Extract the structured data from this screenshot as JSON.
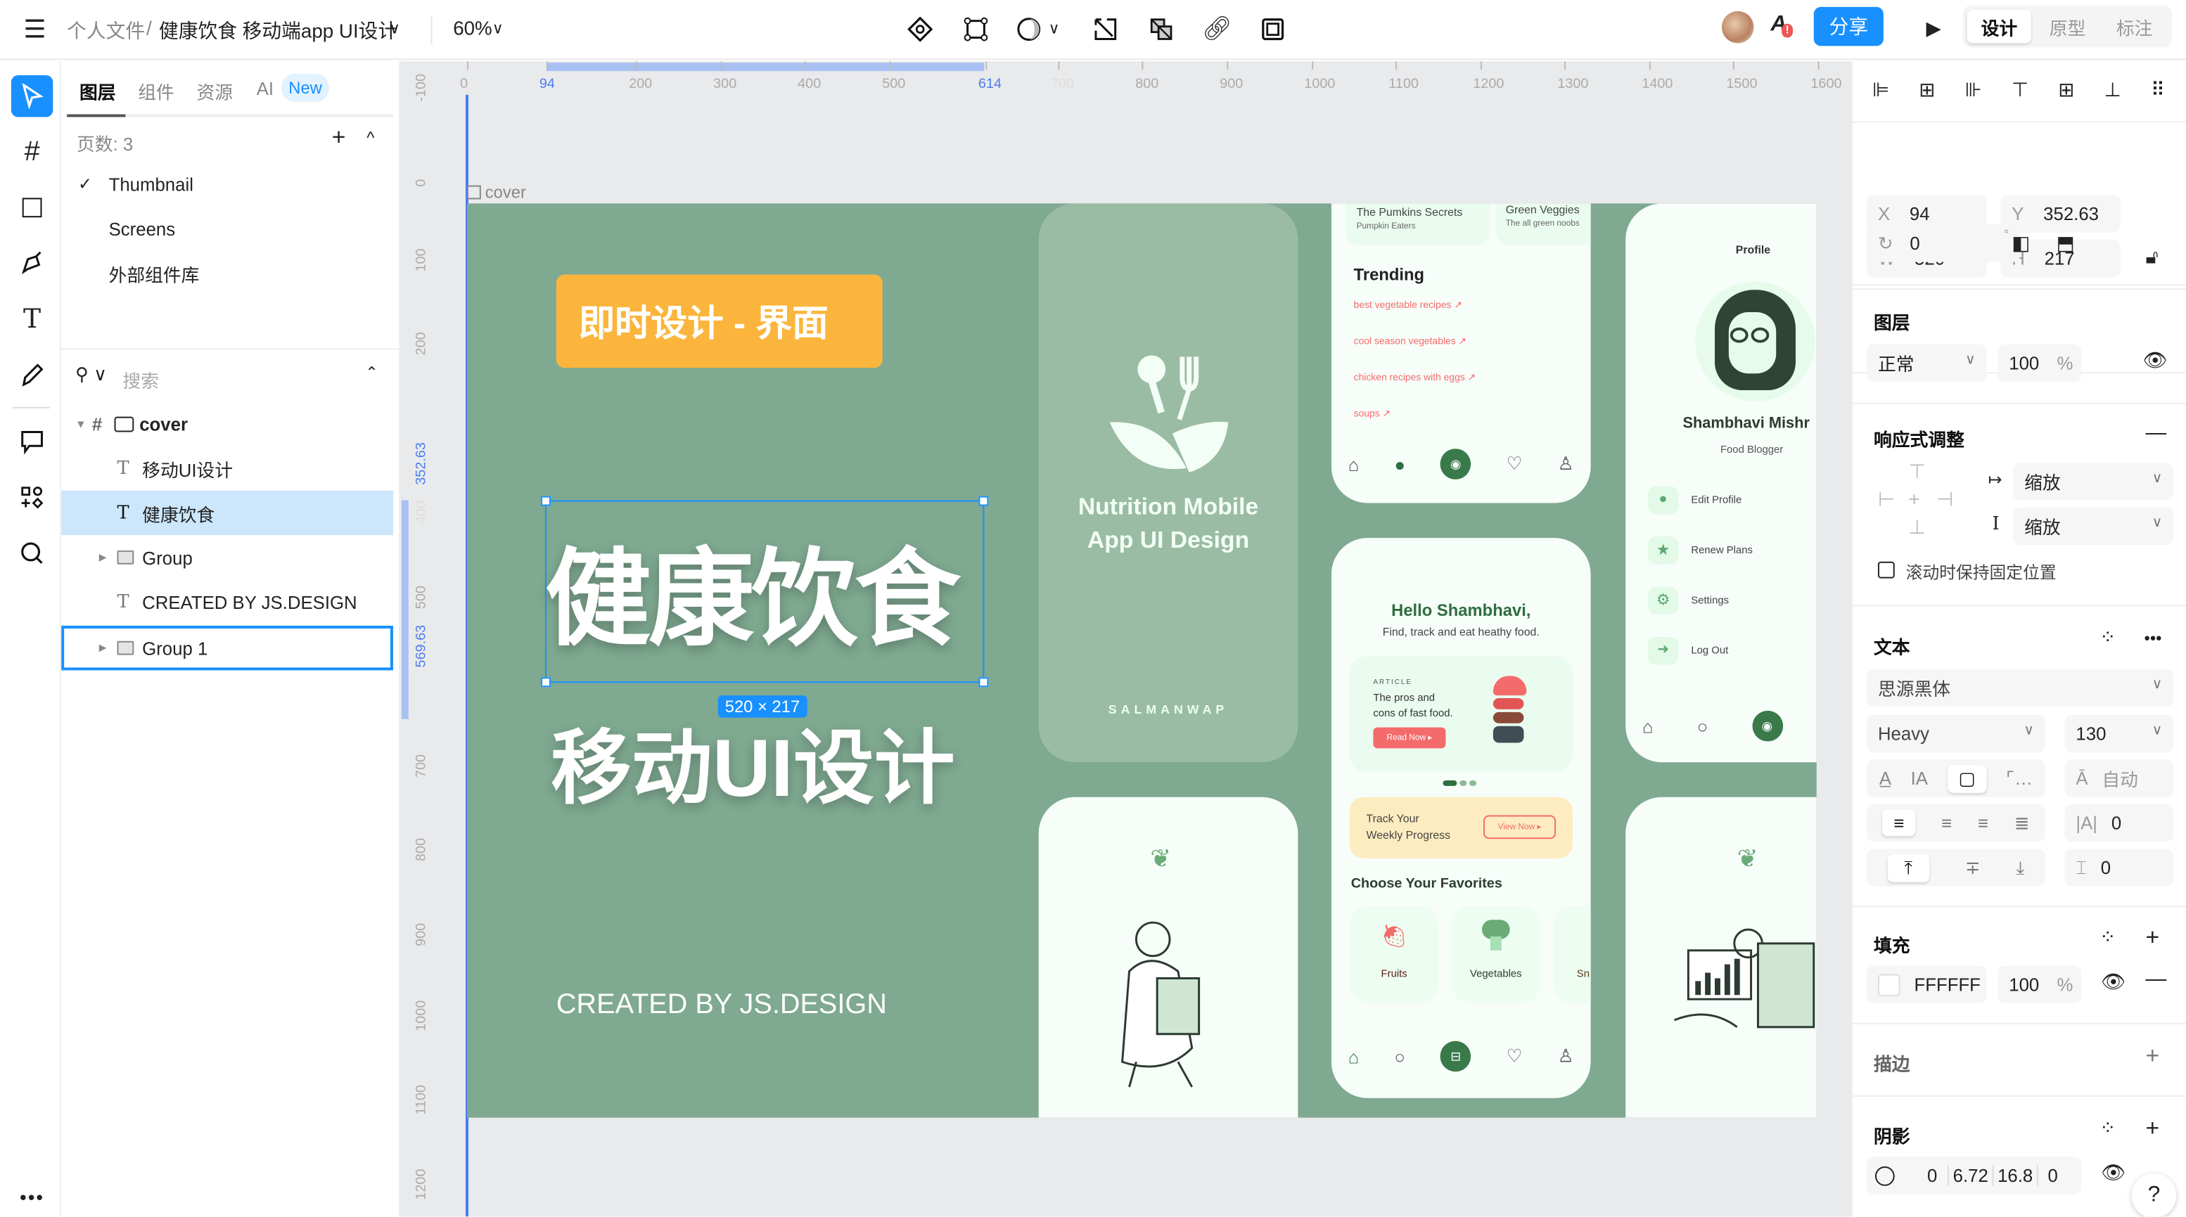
{
  "topbar": {
    "breadcrumb_root": "个人文件",
    "separator": "/",
    "file_name": "健康饮食 移动端app UI设计",
    "zoom": "60%",
    "share_label": "分享",
    "modes": [
      "设计",
      "原型",
      "标注"
    ],
    "active_mode": "设计"
  },
  "left_panel": {
    "tabs": [
      "图层",
      "组件",
      "资源",
      "AI"
    ],
    "new_badge": "New",
    "pages_label": "页数: 3",
    "pages": [
      {
        "name": "Thumbnail",
        "current": true
      },
      {
        "name": "Screens",
        "current": false
      },
      {
        "name": "外部组件库",
        "current": false
      }
    ],
    "search_placeholder": "搜索",
    "layers": [
      {
        "name": "cover",
        "type": "frame",
        "selected": false
      },
      {
        "name": "移动UI设计",
        "type": "text",
        "selected": false
      },
      {
        "name": "健康饮食",
        "type": "text",
        "selected": true
      },
      {
        "name": "Group",
        "type": "group",
        "selected": false
      },
      {
        "name": "CREATED BY JS.DESIGN",
        "type": "text",
        "selected": false
      },
      {
        "name": "Group 1",
        "type": "group",
        "selected": false,
        "hovered": true
      }
    ]
  },
  "rulers": {
    "horizontal": [
      "0",
      "94",
      "200",
      "300",
      "400",
      "500",
      "614",
      "700",
      "800",
      "900",
      "1000",
      "1100",
      "1200",
      "1300",
      "1400",
      "1500",
      "1600"
    ],
    "vertical": [
      "-100",
      "0",
      "100",
      "200",
      "352.63",
      "400",
      "500",
      "569.63",
      "700",
      "800",
      "900",
      "1000",
      "1100",
      "1200"
    ]
  },
  "canvas": {
    "frame_label": "cover",
    "tag_text": "即时设计 - 界面",
    "title": "健康饮食",
    "subtitle": "移动UI设计",
    "credit": "CREATED BY JS.DESIGN",
    "selection_size": "520 × 217",
    "colors": {
      "background": "#7fa991",
      "tag": "#fbb53c",
      "selection": "#1890ff",
      "accent_green": "#3a7a4a",
      "accent_red": "#f46b6b"
    },
    "splash": {
      "title_line1": "Nutrition Mobile",
      "title_line2": "App UI Design",
      "brand": "SALMANWAP"
    },
    "trending": {
      "cards": [
        {
          "title": "The Pumkins Secrets",
          "sub": "Pumpkin Eaters"
        },
        {
          "title": "Green Veggies",
          "sub": "The all green noobs"
        }
      ],
      "heading": "Trending",
      "items": [
        "best vegetable recipes ↗",
        "cool season vegetables ↗",
        "chicken recipes with eggs ↗",
        "soups ↗"
      ]
    },
    "home": {
      "greeting": "Hello Shambhavi,",
      "tagline": "Find, track and eat heathy food.",
      "article_label": "ARTICLE",
      "article_title_1": "The pros and",
      "article_title_2": "cons of fast food.",
      "read_now": "Read Now ▸",
      "track_1": "Track Your",
      "track_2": "Weekly Progress",
      "view_now": "View Now ▸",
      "favorites_heading": "Choose Your Favorites",
      "favorites": [
        "Fruits",
        "Vegetables",
        "Sn"
      ]
    },
    "profile": {
      "heading": "Profile",
      "name": "Shambhavi Mishr",
      "role": "Food Blogger",
      "menu": [
        "Edit Profile",
        "Renew Plans",
        "Settings",
        "Log Out"
      ]
    }
  },
  "right_panel": {
    "x_label": "X",
    "x": "94",
    "y_label": "Y",
    "y": "352.63",
    "w_label": "W",
    "w": "520",
    "h_label": "H",
    "h": "217",
    "rotation": "0",
    "rotation_unit": "°",
    "layer_heading": "图层",
    "blend_mode": "正常",
    "opacity": "100",
    "percent": "%",
    "responsive_heading": "响应式调整",
    "horizontal_constraint": "缩放",
    "vertical_constraint": "缩放",
    "fixed_scroll_label": "滚动时保持固定位置",
    "fixed_scroll_checked": false,
    "text_heading": "文本",
    "font_family": "思源黑体",
    "font_weight": "Heavy",
    "font_size": "130",
    "line_height": "自动",
    "letter_spacing": "0",
    "paragraph_spacing": "0",
    "fill_heading": "填充",
    "fill_color": "FFFFFF",
    "fill_opacity": "100",
    "stroke_heading": "描边",
    "shadow_heading": "阴影",
    "shadow_values": [
      "0",
      "6.72",
      "16.8",
      "0"
    ],
    "help": "?"
  }
}
